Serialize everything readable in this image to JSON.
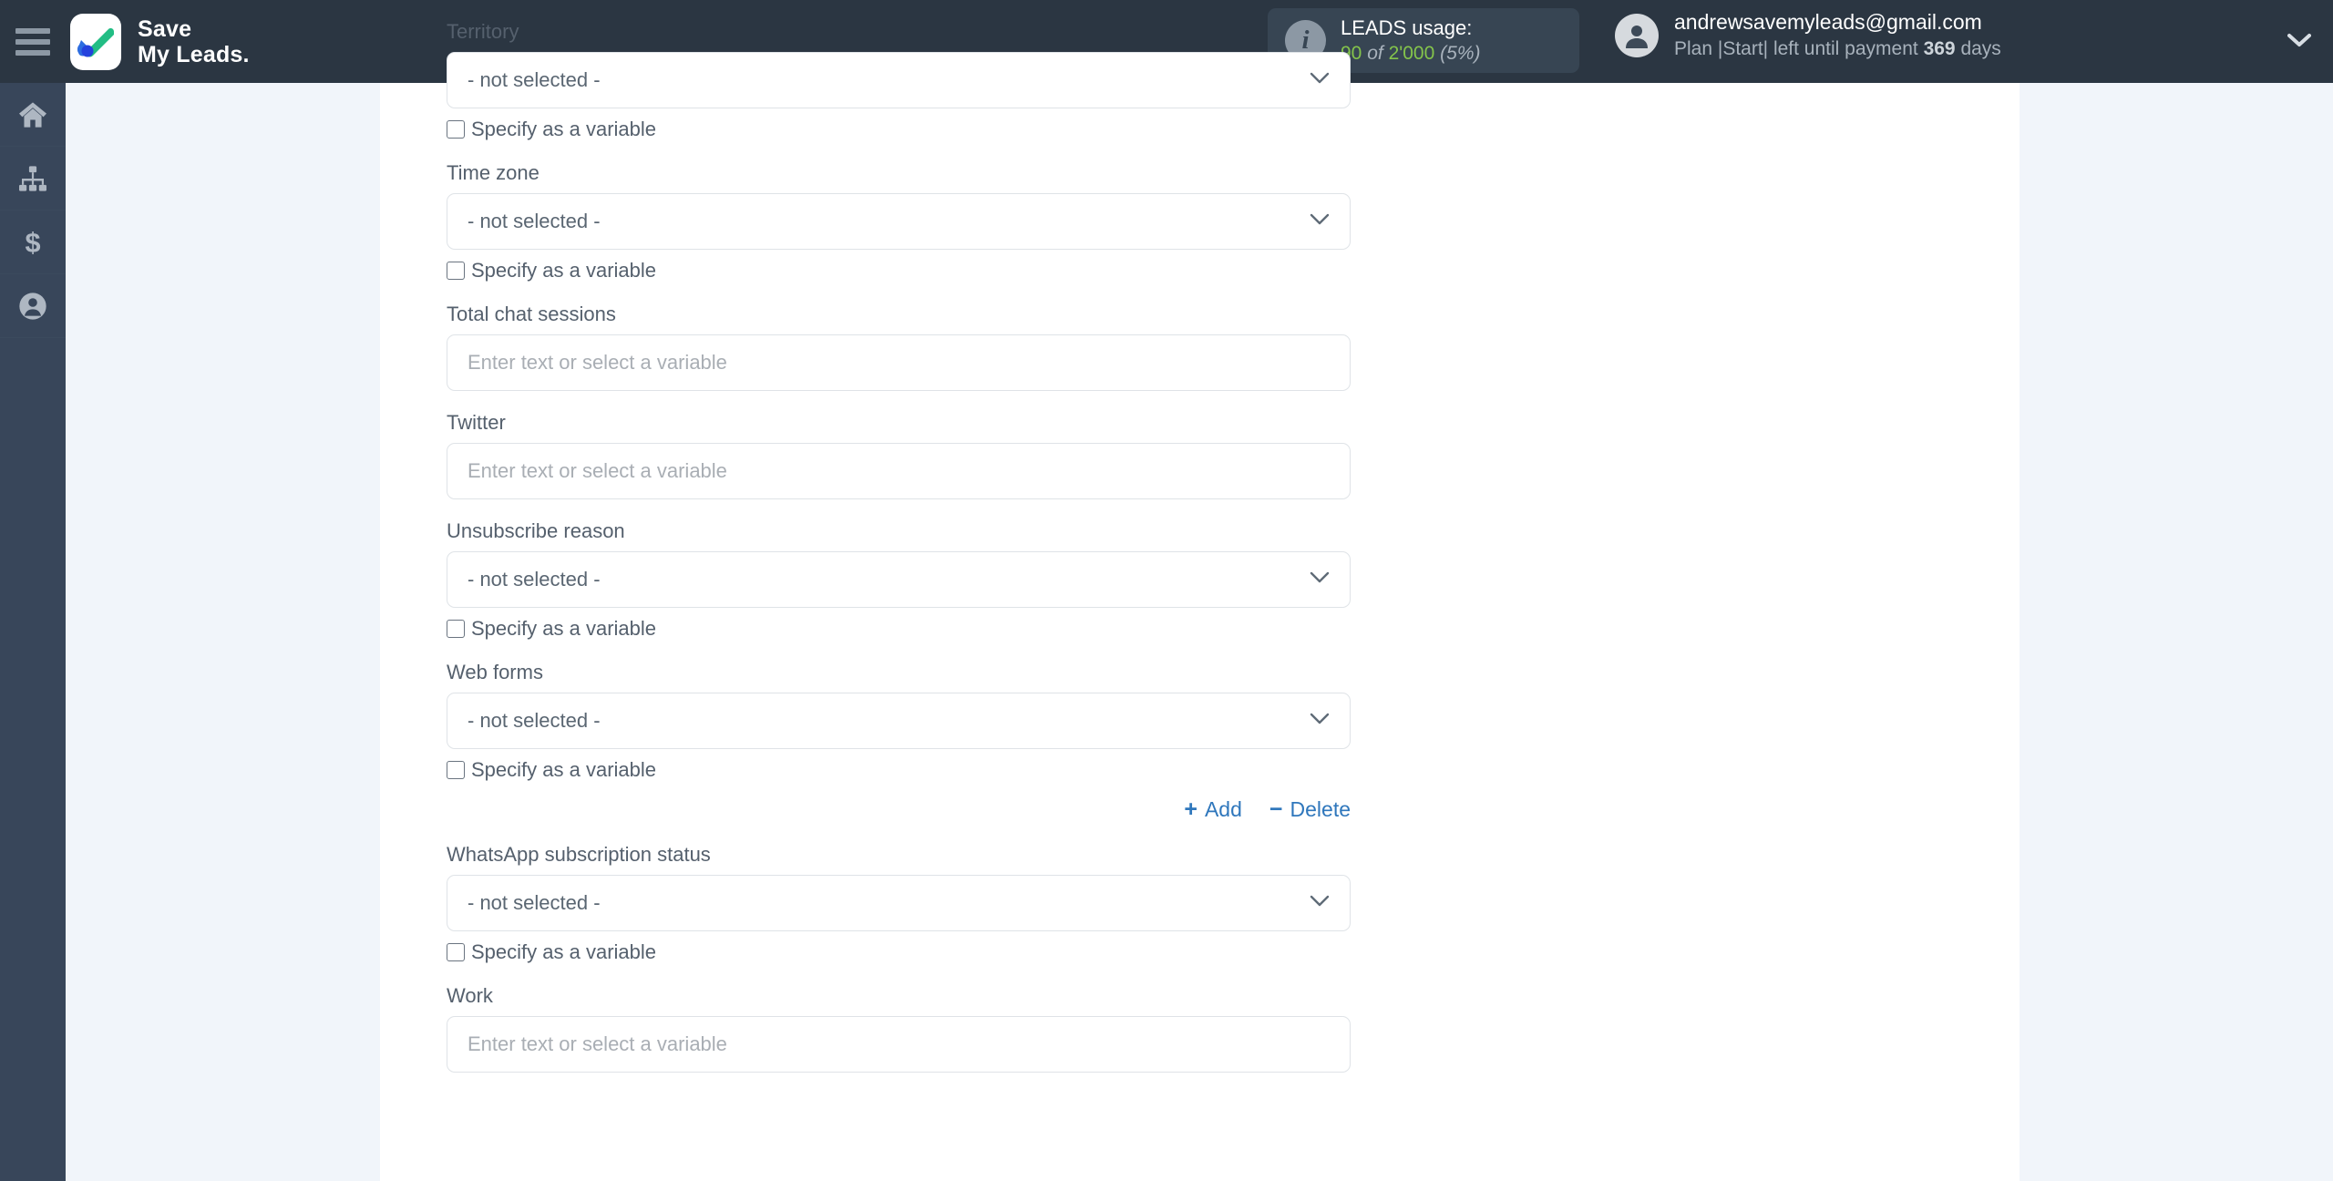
{
  "topbar": {
    "menu_icon": "hamburger-icon",
    "logo_icon": "savemyleads-check-logo",
    "brand_line1": "Save",
    "brand_line2": "My Leads.",
    "usage": {
      "info_icon": "info-icon",
      "title": "LEADS usage:",
      "used": "90",
      "of": "of",
      "total": "2'000",
      "percent": "(5%)"
    },
    "account": {
      "avatar_icon": "user-avatar-icon",
      "email": "andrewsavemyleads@gmail.com",
      "plan_prefix": "Plan |Start| left until payment",
      "days_value": "369",
      "days_suffix": "days",
      "caret_icon": "chevron-down-icon"
    }
  },
  "sidebar": {
    "items": [
      {
        "name": "home",
        "icon": "home-icon"
      },
      {
        "name": "connections",
        "icon": "sitemap-icon"
      },
      {
        "name": "billing",
        "icon": "dollar-icon"
      },
      {
        "name": "profile",
        "icon": "user-circle-icon"
      }
    ]
  },
  "form": {
    "select_placeholder": "- not selected -",
    "input_placeholder": "Enter text or select a variable",
    "checkbox_label": "Specify as a variable",
    "chevron_icon": "chevron-down-icon",
    "fields": [
      {
        "label": "Territory",
        "type": "select",
        "value": "- not selected -",
        "checkbox": true
      },
      {
        "label": "Time zone",
        "type": "select",
        "value": "- not selected -",
        "checkbox": true
      },
      {
        "label": "Total chat sessions",
        "type": "input",
        "value": "",
        "checkbox": false
      },
      {
        "label": "Twitter",
        "type": "input",
        "value": "",
        "checkbox": false
      },
      {
        "label": "Unsubscribe reason",
        "type": "select",
        "value": "- not selected -",
        "checkbox": true
      },
      {
        "label": "Web forms",
        "type": "select",
        "value": "- not selected -",
        "checkbox": true,
        "actions": true
      },
      {
        "label": "WhatsApp subscription status",
        "type": "select",
        "value": "- not selected -",
        "checkbox": true
      },
      {
        "label": "Work",
        "type": "input",
        "value": "",
        "checkbox": false
      }
    ],
    "actions": {
      "add_symbol": "+",
      "add_label": "Add",
      "delete_symbol": "−",
      "delete_label": "Delete"
    }
  },
  "colors": {
    "topbar_bg": "#2b3642",
    "rail_bg": "#38465a",
    "page_bg": "#f1f5fa",
    "panel_bg": "#ffffff",
    "accent_link": "#2f77bc",
    "usage_green": "#84c44b",
    "label_text": "#55606d",
    "placeholder_text": "#a9aeb4"
  }
}
